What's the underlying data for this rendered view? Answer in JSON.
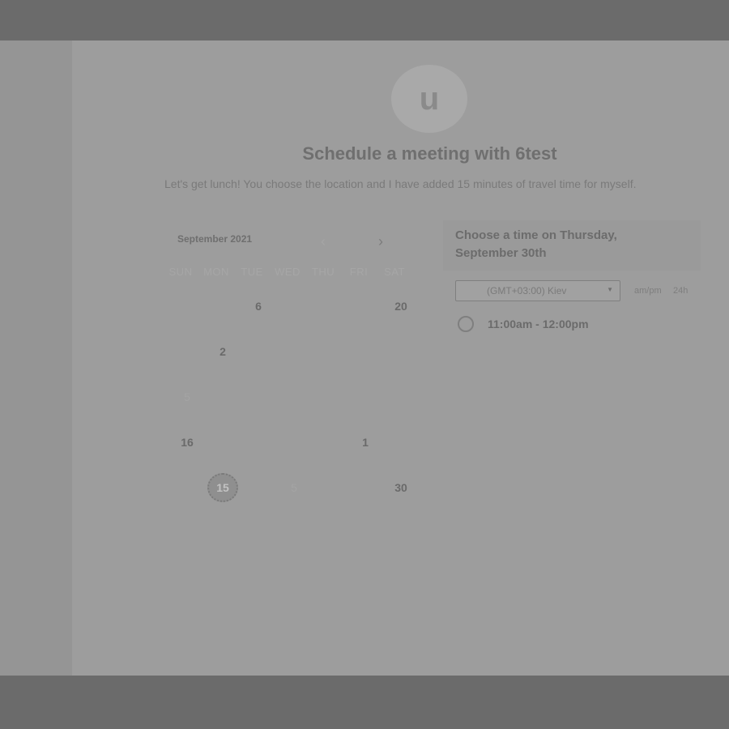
{
  "avatar": {
    "letter": "u"
  },
  "title": "Schedule a meeting with 6test",
  "description": "Let's get lunch! You choose the location and I have added 15 minutes of travel time for myself.",
  "calendar": {
    "month_label": "September 2021",
    "prev_icon": "‹",
    "next_icon": "›",
    "weekdays": [
      "SUN",
      "MON",
      "TUE",
      "WED",
      "THU",
      "FRI",
      "SAT"
    ],
    "days": [
      "6",
      "20",
      "2",
      "5",
      "16",
      "1",
      "15",
      "5",
      "30"
    ],
    "today": "15"
  },
  "time_panel": {
    "heading": "Choose a time on Thursday, September 30th",
    "timezone": "(GMT+03:00) Kiev",
    "format_ampm": "am/pm",
    "format_24h": "24h",
    "slots": [
      "11:00am - 12:00pm"
    ]
  }
}
